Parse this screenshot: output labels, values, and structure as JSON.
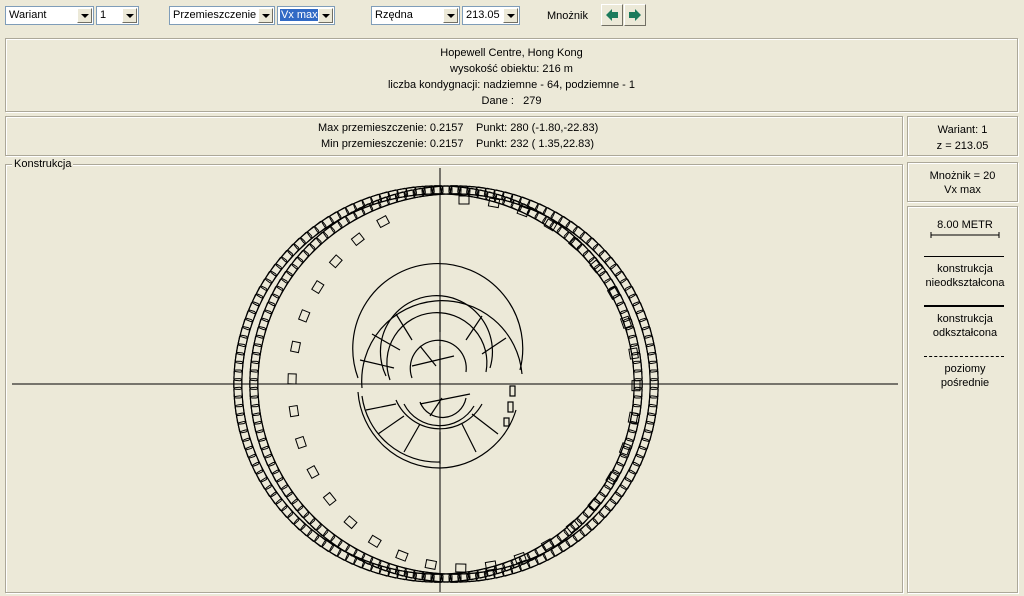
{
  "toolbar": {
    "variant_combo": "Wariant",
    "variant_number": "1",
    "mode_combo": "Przemieszczenie",
    "component_combo": "Vx max",
    "level_combo": "Rzędna",
    "level_value": "213.05",
    "multiplier_label": "Mnożnik"
  },
  "info": {
    "building_name": "Hopewell Centre, Hong Kong",
    "height": "wysokość obiektu: 216 m",
    "floors": "liczba kondygnacji: nadziemne - 64, podziemne - 1",
    "data_label": "Dane :",
    "data_value": "279"
  },
  "results": {
    "max_label": "Max przemieszczenie: 0.2157",
    "max_point": "Punkt: 280 (-1.80,-22.83)",
    "min_label": "Min przemieszczenie: 0.2157",
    "min_point": "Punkt: 232 ( 1.35,22.83)"
  },
  "side": {
    "variant": "Wariant: 1",
    "z": "z = 213.05",
    "multiplier": "Mnożnik = 20",
    "component": "Vx max",
    "scale_label": "8.00  METR",
    "legend_undeformed_1": "konstrukcja",
    "legend_undeformed_2": "nieodkształcona",
    "legend_deformed_1": "konstrukcja",
    "legend_deformed_2": "odkształcona",
    "legend_levels_1": "poziomy",
    "legend_levels_2": "pośrednie"
  },
  "canvas": {
    "caption": "Konstrukcja"
  },
  "colors": {
    "background": "#ece9d8",
    "selection": "#316ac5",
    "arrow_icon": "#1c7b5c"
  }
}
